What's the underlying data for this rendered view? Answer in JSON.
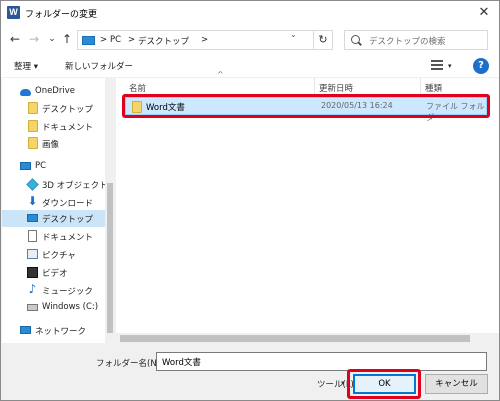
{
  "titlebar": {
    "title": "フォルダーの変更",
    "app_icon": "W",
    "close": "✕"
  },
  "nav": {
    "back": "←",
    "forward": "→",
    "recent": "⌄",
    "up": "↑",
    "address": [
      "PC",
      "デスクトップ"
    ],
    "separator": ">",
    "address_dropdown": "⌄",
    "refresh": "↻",
    "search_placeholder": "デスクトップの検索"
  },
  "toolbar": {
    "organize": "整理 ▾",
    "new_folder": "新しいフォルダー",
    "help": "?"
  },
  "sidebar": {
    "items": [
      {
        "label": "OneDrive",
        "icon": "cloud-icon"
      },
      {
        "label": "デスクトップ",
        "icon": "folder-icon"
      },
      {
        "label": "ドキュメント",
        "icon": "folder-icon"
      },
      {
        "label": "画像",
        "icon": "folder-icon"
      },
      {
        "label": "PC",
        "icon": "pc-icon"
      },
      {
        "label": "3D オブジェクト",
        "icon": "3d-objects-icon"
      },
      {
        "label": "ダウンロード",
        "icon": "download-icon"
      },
      {
        "label": "デスクトップ",
        "icon": "desktop-icon",
        "selected": true
      },
      {
        "label": "ドキュメント",
        "icon": "document-icon"
      },
      {
        "label": "ピクチャ",
        "icon": "pictures-icon"
      },
      {
        "label": "ビデオ",
        "icon": "video-icon"
      },
      {
        "label": "ミュージック",
        "icon": "music-icon"
      },
      {
        "label": "Windows (C:)",
        "icon": "drive-icon"
      },
      {
        "label": "ネットワーク",
        "icon": "network-icon"
      }
    ]
  },
  "file_list": {
    "columns": [
      "名前",
      "更新日時",
      "種類"
    ],
    "rows": [
      {
        "name": "Word文書",
        "date": "2020/05/13 16:24",
        "type": "ファイル フォルダー",
        "selected": true
      }
    ]
  },
  "footer": {
    "folder_name_label": "フォルダー名(N):",
    "folder_name_value": "Word文書",
    "tools_label": "ツール(L)",
    "ok_label": "OK",
    "cancel_label": "キャンセル"
  },
  "colors": {
    "highlight": "#e0001b",
    "selection": "#cce8ff",
    "accent": "#0078d7"
  }
}
